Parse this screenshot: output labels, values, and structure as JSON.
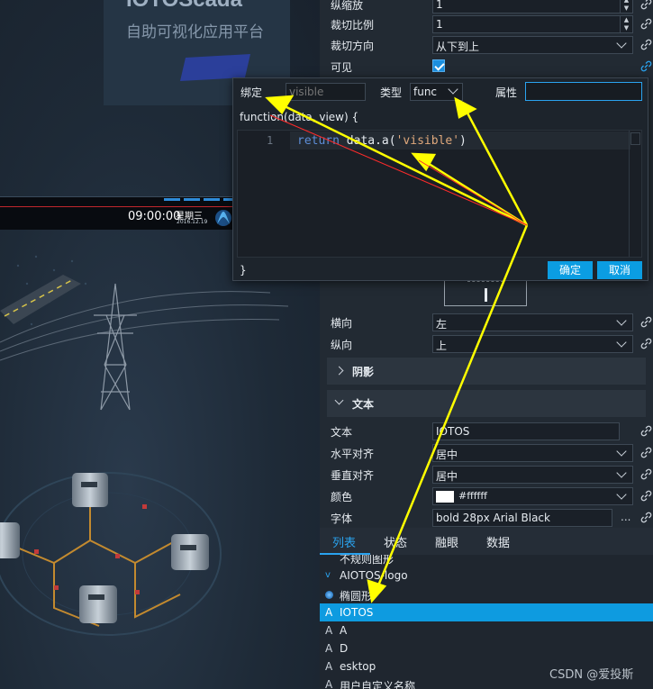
{
  "canvas": {
    "logo_title": "IOTOScada",
    "logo_subtitle": "自助可视化应用平台",
    "clock": "09:00:00",
    "weekday": "星期三",
    "date": "2016.12.19"
  },
  "props_top": [
    {
      "label": "纵缩放",
      "value": "1",
      "kind": "spin"
    },
    {
      "label": "裁切比例",
      "value": "1",
      "kind": "spin"
    },
    {
      "label": "裁切方向",
      "value": "从下到上",
      "kind": "select"
    },
    {
      "label": "可见",
      "value": "",
      "kind": "checkbox",
      "checked": true
    }
  ],
  "popup": {
    "bind_label": "绑定",
    "bind_placeholder": "visible",
    "type_label": "类型",
    "type_value": "func",
    "attr_label": "属性",
    "func_signature": "function(data, view) {",
    "code_line_number": "1",
    "code_keyword": "return",
    "code_mid": " data.a(",
    "code_string": "'visible'",
    "code_end": ")",
    "func_end": "}",
    "confirm_label": "确定",
    "cancel_label": "取消"
  },
  "props_align": [
    {
      "label": "横向",
      "value": "左"
    },
    {
      "label": "纵向",
      "value": "上"
    }
  ],
  "sections": {
    "shadow": "阴影",
    "text": "文本"
  },
  "props_text": {
    "text_label": "文本",
    "text_value": "IOTOS",
    "halign_label": "水平对齐",
    "halign_value": "居中",
    "valign_label": "垂直对齐",
    "valign_value": "居中",
    "color_label": "颜色",
    "color_value": "#ffffff",
    "font_label": "字体",
    "font_value": "bold 28px Arial Black",
    "font_more": "..."
  },
  "tabs": [
    "列表",
    "状态",
    "融眼",
    "数据"
  ],
  "tree": [
    {
      "label": "不规则图形",
      "icon": "",
      "partial": true
    },
    {
      "label": "AIOTOS-logo",
      "icon": "v"
    },
    {
      "label": "椭圆形",
      "icon": "dot"
    },
    {
      "label": "IOTOS",
      "icon": "A",
      "selected": true
    },
    {
      "label": "A",
      "icon": "A"
    },
    {
      "label": "D",
      "icon": "A"
    },
    {
      "label": "esktop",
      "icon": "A"
    },
    {
      "label": "用户自定义名称",
      "icon": "A"
    }
  ],
  "watermark": "CSDN @爱投斯",
  "colors": {
    "accent": "#0b9de2",
    "selected_row": "#0e9be0",
    "annotation_arrow": "#ffff00"
  }
}
